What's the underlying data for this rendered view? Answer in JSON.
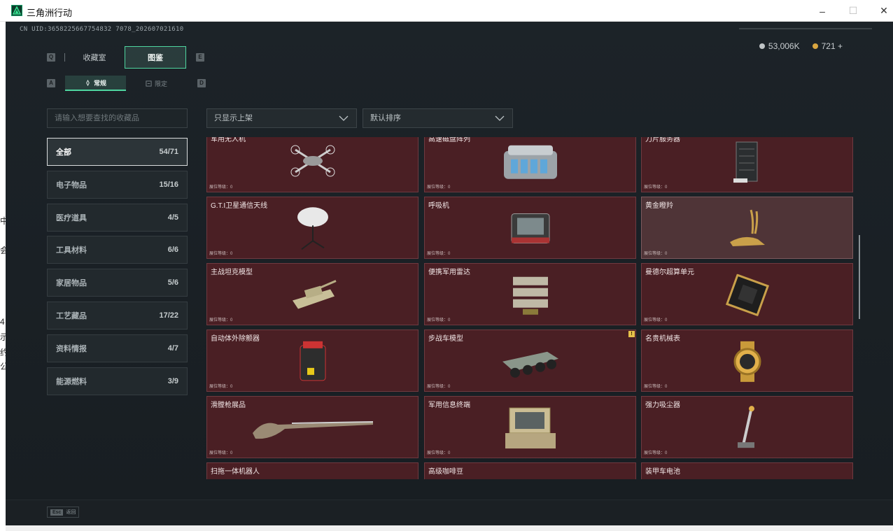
{
  "window": {
    "title": "三角洲行动",
    "minimize_glyph": "–",
    "maximize_glyph": "☐",
    "close_glyph": "✕"
  },
  "left_strip_text": [
    "中",
    "会",
    "4",
    "示",
    "约",
    "公"
  ],
  "uid": "CN UID:3658225667754832 7078_202607021610",
  "currency": {
    "silver": "53,006K",
    "gold": "721 +"
  },
  "keys": {
    "q": "Q",
    "e": "E",
    "a": "A",
    "d": "D"
  },
  "tabs": {
    "main": [
      "收藏室",
      "图鉴"
    ],
    "active_main": 1,
    "sub": [
      "常规",
      "限定"
    ],
    "active_sub": 0
  },
  "search": {
    "placeholder": "请输入想要查找的收藏品"
  },
  "filters": {
    "shelf": "只显示上架",
    "sort": "默认排序"
  },
  "categories": [
    {
      "label": "全部",
      "count": "54/71"
    },
    {
      "label": "电子物品",
      "count": "15/16"
    },
    {
      "label": "医疗道具",
      "count": "4/5"
    },
    {
      "label": "工具材料",
      "count": "6/6"
    },
    {
      "label": "家居物品",
      "count": "5/6"
    },
    {
      "label": "工艺藏品",
      "count": "17/22"
    },
    {
      "label": "资料情报",
      "count": "4/7"
    },
    {
      "label": "能源燃料",
      "count": "3/9"
    }
  ],
  "level_label": "展位等级：0",
  "items": [
    {
      "name": "军用无人机",
      "icon": "drone-icon"
    },
    {
      "name": "高速磁盘阵列",
      "icon": "disk-array-icon"
    },
    {
      "name": "刀片服务器",
      "icon": "server-icon"
    },
    {
      "name": "G.T.I卫星通信天线",
      "icon": "satellite-dish-icon"
    },
    {
      "name": "呼吸机",
      "icon": "ventilator-icon"
    },
    {
      "name": "黄金瞪羚",
      "icon": "gold-gazelle-icon"
    },
    {
      "name": "主战坦克模型",
      "icon": "tank-model-icon"
    },
    {
      "name": "便携军用雷达",
      "icon": "radar-icon"
    },
    {
      "name": "曼德尔超算单元",
      "icon": "cpu-unit-icon"
    },
    {
      "name": "自动体外除颤器",
      "icon": "defibrillator-icon"
    },
    {
      "name": "步战车模型",
      "icon": "ifv-model-icon"
    },
    {
      "name": "名贵机械表",
      "icon": "watch-icon"
    },
    {
      "name": "滑膛枪展品",
      "icon": "musket-icon"
    },
    {
      "name": "军用信息终端",
      "icon": "terminal-icon"
    },
    {
      "name": "强力吸尘器",
      "icon": "vacuum-icon"
    },
    {
      "name": "扫拖一体机器人",
      "icon": "robot-vacuum-icon"
    },
    {
      "name": "高级咖啡豆",
      "icon": "coffee-beans-icon"
    },
    {
      "name": "装甲车电池",
      "icon": "battery-icon"
    }
  ],
  "badge_on_item": {
    "index": 10,
    "text": "!"
  },
  "esc": {
    "key": "Esc",
    "label": "返回"
  },
  "colors": {
    "accent": "#4fd6a0",
    "card_bg": "#4a1f24",
    "card_highlight": "#4f3437",
    "gold": "#d9a640"
  }
}
